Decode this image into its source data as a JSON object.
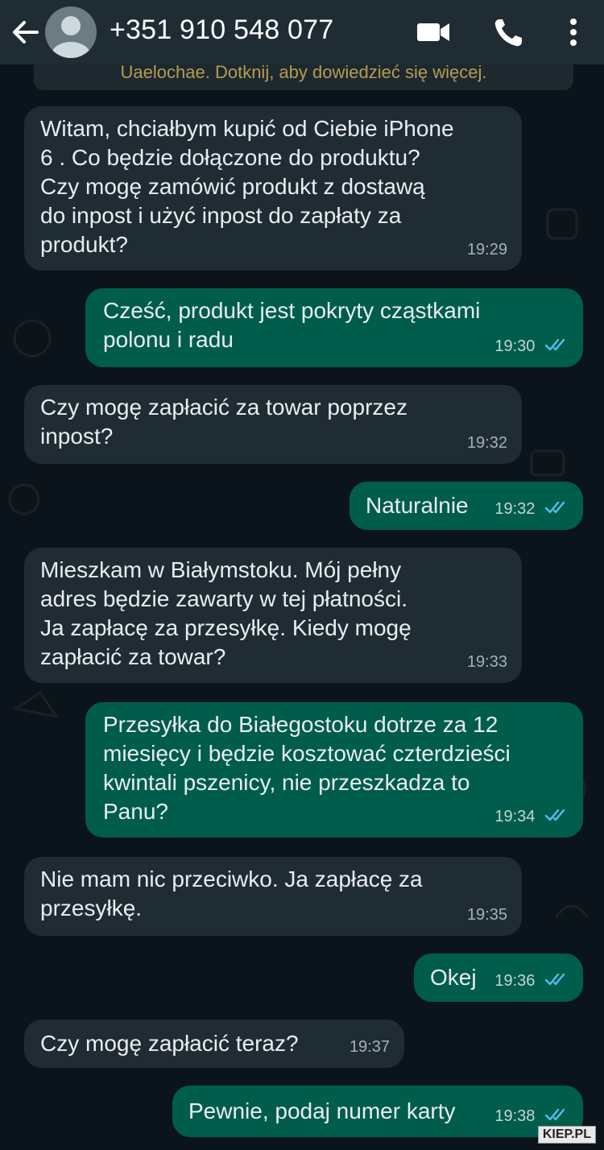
{
  "header": {
    "contact_name": "+351 910 548 077",
    "back_icon": "arrow-left-icon",
    "video_icon": "video-camera-icon",
    "call_icon": "phone-icon",
    "menu_icon": "kebab-menu-icon"
  },
  "colors": {
    "header_bg": "#1f2c34",
    "chat_bg": "#0b141a",
    "incoming_bubble": "#202c33",
    "outgoing_bubble": "#005c4b",
    "read_ticks": "#53bdeb"
  },
  "notice": {
    "text": "Uaelochae. Dotknij, aby dowiedzieć się więcej."
  },
  "messages": [
    {
      "dir": "in",
      "text": "Witam, chciałbym kupić od Ciebie iPhone\n6 . Co będzie dołączone do produktu?\nCzy mogę zamówić produkt z dostawą\ndo inpost i użyć inpost do zapłaty za\nprodukt?",
      "time": "19:29"
    },
    {
      "dir": "out",
      "text": "Cześć, produkt jest pokryty cząstkami\npolonu i radu",
      "time": "19:30",
      "status": "read"
    },
    {
      "dir": "in",
      "text": "Czy mogę zapłacić za towar poprzez\ninpost?",
      "time": "19:32"
    },
    {
      "dir": "out",
      "text": "Naturalnie",
      "time": "19:32",
      "status": "read"
    },
    {
      "dir": "in",
      "text": "Mieszkam w Białymstoku. Mój pełny\nadres będzie zawarty w tej płatności.\nJa zapłacę za przesyłkę. Kiedy mogę\nzapłacić za towar?",
      "time": "19:33"
    },
    {
      "dir": "out",
      "text": "Przesyłka do Białegostoku dotrze za 12\nmiesięcy i będzie kosztować czterdzieści\nkwintali pszenicy, nie przeszkadza to\nPanu?",
      "time": "19:34",
      "status": "read"
    },
    {
      "dir": "in",
      "text": "Nie mam nic przeciwko. Ja zapłacę za\nprzesyłkę.",
      "time": "19:35"
    },
    {
      "dir": "out",
      "text": "Okej",
      "time": "19:36",
      "status": "read"
    },
    {
      "dir": "in",
      "text": "Czy mogę zapłacić teraz?",
      "time": "19:37"
    },
    {
      "dir": "out",
      "text": "Pewnie, podaj numer karty",
      "time": "19:38",
      "status": "read"
    }
  ],
  "watermark": "KIEP.PL"
}
